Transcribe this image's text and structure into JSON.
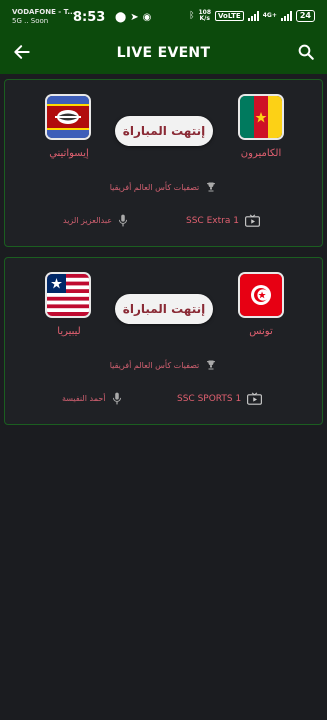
{
  "status_bar": {
    "carrier": "VODAFONE - T...",
    "carrier_sub": "5G .. Soon",
    "time": "8:53",
    "speed_value": "108",
    "speed_unit": "K/s",
    "volte": "VoLTE",
    "lte": "4G+",
    "battery": "24"
  },
  "app_bar": {
    "title": "LIVE EVENT",
    "back_icon": "back-arrow-icon",
    "search_icon": "search-icon",
    "color": "#0c4a0c"
  },
  "events": [
    {
      "home_team": "الكاميرون",
      "away_team": "إيسواتيني",
      "status": "إنتهت المباراة",
      "competition": "تصفيات كأس العالم أفريقيا",
      "channel": "SSC Extra 1",
      "commentator": "عبدالعزيز الزيد"
    },
    {
      "home_team": "تونس",
      "away_team": "ليبيريا",
      "status": "إنتهت المباراة",
      "competition": "تصفيات كأس العالم أفريقيا",
      "channel": "SSC SPORTS 1",
      "commentator": "أحمد النفيسة"
    }
  ],
  "colors": {
    "background": "#1b1c20",
    "card_border": "#1b5e20",
    "accent_text": "#e06070",
    "pill_text": "#8a2a35"
  }
}
